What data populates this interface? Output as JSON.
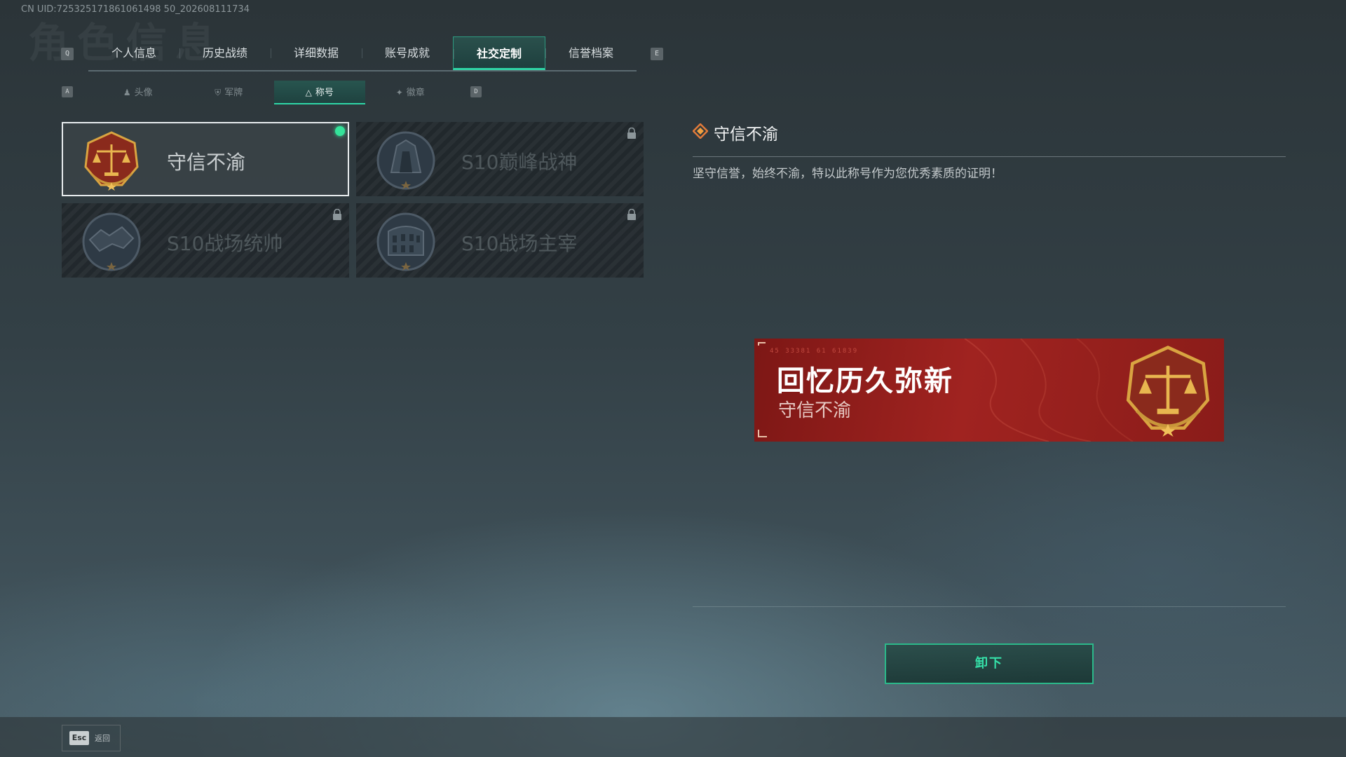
{
  "uid_text": "CN UID:725325171861061498 50_202608111734",
  "bg_title": "角色信息",
  "tabs": {
    "prev_key": "Q",
    "next_key": "E",
    "items": [
      {
        "label": "个人信息"
      },
      {
        "label": "历史战绩"
      },
      {
        "label": "详细数据"
      },
      {
        "label": "账号成就"
      },
      {
        "label": "社交定制"
      },
      {
        "label": "信誉档案"
      }
    ],
    "active_index": 4
  },
  "subtabs": {
    "prev_key": "A",
    "next_key": "D",
    "items": [
      {
        "label": "头像",
        "icon": "person-icon"
      },
      {
        "label": "军牌",
        "icon": "dogtag-icon"
      },
      {
        "label": "称号",
        "icon": "triangle-icon"
      },
      {
        "label": "徽章",
        "icon": "emblem-icon"
      }
    ],
    "active_index": 2
  },
  "titles": [
    {
      "name": "守信不渝",
      "badge": "scales-badge-icon",
      "locked": false,
      "selected": true,
      "equipped": true
    },
    {
      "name": "S10巅峰战神",
      "badge": "warrior-badge-icon",
      "locked": true,
      "selected": false,
      "equipped": false
    },
    {
      "name": "S10战场统帅",
      "badge": "wolf-badge-icon",
      "locked": true,
      "selected": false,
      "equipped": false
    },
    {
      "name": "S10战场主宰",
      "badge": "colosseum-badge-icon",
      "locked": true,
      "selected": false,
      "equipped": false
    }
  ],
  "detail": {
    "title": "守信不渝",
    "description": "坚守信誉，始终不渝，特以此称号作为您优秀素质的证明！"
  },
  "preview": {
    "main_text": "回忆历久弥新",
    "sub_text": "守信不渝",
    "code_text": "45 33381  61 61839"
  },
  "actions": {
    "unequip_label": "卸下",
    "esc_key": "Esc",
    "back_label": "返回"
  },
  "colors": {
    "accent": "#2fd6a6",
    "equipped_dot": "#34e39a",
    "preview_red": "#a02320",
    "badge_gold": "#d9a441"
  }
}
